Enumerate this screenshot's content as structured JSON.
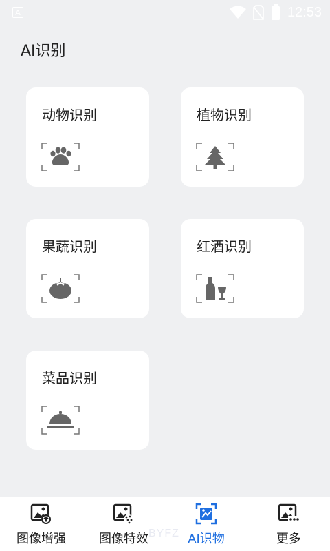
{
  "status_bar": {
    "left_badge": "A",
    "time": "12:53"
  },
  "page": {
    "title": "AI识别"
  },
  "cards": [
    {
      "label": "动物识别",
      "icon": "paw-icon"
    },
    {
      "label": "植物识别",
      "icon": "tree-icon"
    },
    {
      "label": "果蔬识别",
      "icon": "tomato-icon"
    },
    {
      "label": "红酒识别",
      "icon": "wine-icon"
    },
    {
      "label": "菜品识别",
      "icon": "dish-cloche-icon"
    }
  ],
  "tabs": [
    {
      "label": "图像增强",
      "icon": "image-enhance-icon",
      "active": false
    },
    {
      "label": "图像特效",
      "icon": "image-effects-icon",
      "active": false
    },
    {
      "label": "AI识物",
      "icon": "ai-recognize-icon",
      "active": true
    },
    {
      "label": "更多",
      "icon": "more-image-icon",
      "active": false
    }
  ],
  "watermark": "BYFZ",
  "colors": {
    "background": "#eff0f2",
    "card": "#ffffff",
    "active_tab": "#1f6fe0",
    "icon_gray": "#666666"
  }
}
